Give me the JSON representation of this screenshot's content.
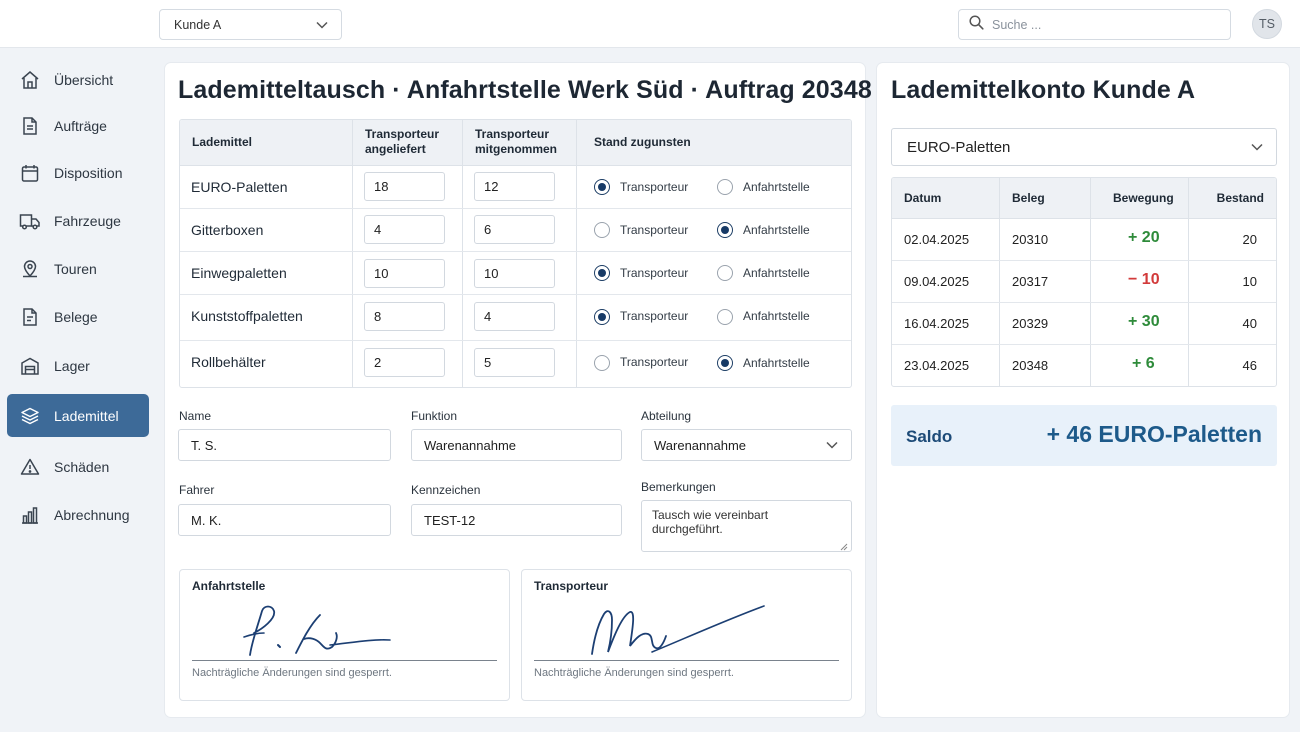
{
  "header": {
    "customer_select": "Kunde A",
    "search_placeholder": "Suche ...",
    "avatar_initials": "TS"
  },
  "sidebar": {
    "active_color": "#3d6a98",
    "items": [
      {
        "label": "Übersicht",
        "icon": "home-icon"
      },
      {
        "label": "Aufträge",
        "icon": "document-icon"
      },
      {
        "label": "Disposition",
        "icon": "calendar-icon"
      },
      {
        "label": "Fahrzeuge",
        "icon": "truck-icon"
      },
      {
        "label": "Touren",
        "icon": "map-pin-icon"
      },
      {
        "label": "Belege",
        "icon": "receipt-icon"
      },
      {
        "label": "Lager",
        "icon": "warehouse-icon"
      },
      {
        "label": "Lademittel",
        "icon": "layers-icon",
        "active": true
      },
      {
        "label": "Schäden",
        "icon": "warning-icon"
      },
      {
        "label": "Abrechnung",
        "icon": "bar-chart-icon"
      }
    ]
  },
  "exchange": {
    "title": "Lademitteltausch · Anfahrtstelle Werk Süd · Auftrag 20348",
    "columns": {
      "item": "Lademittel",
      "delivered_1": "Transporteur",
      "delivered_2": "angeliefert",
      "taken_1": "Transporteur",
      "taken_2": "mitgenommen",
      "balance": "Stand zugunsten"
    },
    "option_a": "Transporteur",
    "option_b": "Anfahrtstelle",
    "rows": [
      {
        "name": "EURO-Paletten",
        "delivered": "18",
        "taken": "12",
        "favor": "Transporteur"
      },
      {
        "name": "Gitterboxen",
        "delivered": "4",
        "taken": "6",
        "favor": "Anfahrtstelle"
      },
      {
        "name": "Einwegpaletten",
        "delivered": "10",
        "taken": "10",
        "favor": "Transporteur"
      },
      {
        "name": "Kunststoffpaletten",
        "delivered": "8",
        "taken": "4",
        "favor": "Transporteur"
      },
      {
        "name": "Rollbehälter",
        "delivered": "2",
        "taken": "5",
        "favor": "Anfahrtstelle"
      }
    ]
  },
  "form": {
    "name_label": "Name",
    "name_value": "T. S.",
    "function_label": "Funktion",
    "function_value": "Warenannahme",
    "department_label": "Abteilung",
    "department_value": "Warenannahme",
    "driver_label": "Fahrer",
    "driver_value": "M. K.",
    "plate_label": "Kennzeichen",
    "plate_value": "TEST-12",
    "remarks_label": "Bemerkungen",
    "remarks_value": "Tausch wie vereinbart durchgeführt."
  },
  "signatures": {
    "left_title": "Anfahrtstelle",
    "right_title": "Transporteur",
    "note": "Nachträgliche Änderungen sind gesperrt."
  },
  "account": {
    "title": "Lademittelkonto Kunde A",
    "type_select": "EURO-Paletten",
    "columns": {
      "date": "Datum",
      "doc": "Beleg",
      "movement": "Bewegung",
      "stock": "Bestand"
    },
    "rows": [
      {
        "date": "02.04.2025",
        "doc": "20310",
        "movement": "+ 20",
        "sign": "pos",
        "stock": "20"
      },
      {
        "date": "09.04.2025",
        "doc": "20317",
        "movement": "− 10",
        "sign": "neg",
        "stock": "10"
      },
      {
        "date": "16.04.2025",
        "doc": "20329",
        "movement": "+ 30",
        "sign": "pos",
        "stock": "40"
      },
      {
        "date": "23.04.2025",
        "doc": "20348",
        "movement": "+ 6",
        "sign": "pos",
        "stock": "46"
      }
    ],
    "saldo_label": "Saldo",
    "saldo_value": "+ 46 EURO-Paletten",
    "positive_color": "#2e8b3a",
    "negative_color": "#d23a3a"
  }
}
